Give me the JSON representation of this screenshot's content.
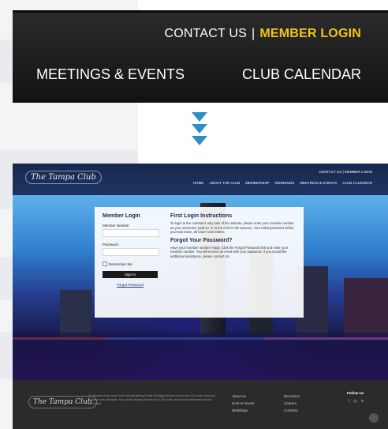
{
  "zoom": {
    "contact_label": "CONTACT US",
    "separator": "|",
    "member_login_label": "MEMBER LOGIN",
    "nav": [
      "MEETINGS & EVENTS",
      "CLUB CALENDAR"
    ]
  },
  "site": {
    "logo_text": "The Tampa Club",
    "top_links": {
      "contact": "CONTACT US",
      "separator": "|",
      "member_login": "MEMBER LOGIN"
    },
    "nav": [
      "HOME",
      "ABOUT THE CLUB",
      "MEMBERSHIP",
      "WEDDINGS",
      "MEETINGS & EVENTS",
      "CLUB CALENDAR"
    ],
    "login": {
      "title": "Member Login",
      "member_number_label": "Member Number",
      "password_label": "Password",
      "remember_label": "Remember Me",
      "signin_label": "Sign In",
      "forgot_label": "Forgot Password"
    },
    "instructions": {
      "first_title": "First Login Instructions",
      "first_text": "To login to the member's only side of the website, please enter your member number as your username (add an 'S' to the end for the spouse). Your initial password will be your last name, all lower case letters.",
      "forgot_title": "Forgot Your Password?",
      "forgot_text": "Have your member number ready. Click the Forgot Password link and enter your member number. You will receive an email with your password. If you would like additional assistance, please contact Us."
    },
    "footer": {
      "logo_text": "The Tampa Club",
      "description": "Our Members have access to the industry-leading Private Advantage Network of more than 300 country clubs and business clubs nationwide. Plus, special offerings at more than 1,000 hotels, resorts and entertainment venues. Learn More",
      "col1": [
        "About us",
        "Host An Event",
        "Weddings"
      ],
      "col2": [
        "Directions",
        "Careers",
        "Contacts"
      ],
      "follow_label": "Follow Us",
      "social": [
        "f",
        "◎",
        "in"
      ]
    }
  }
}
